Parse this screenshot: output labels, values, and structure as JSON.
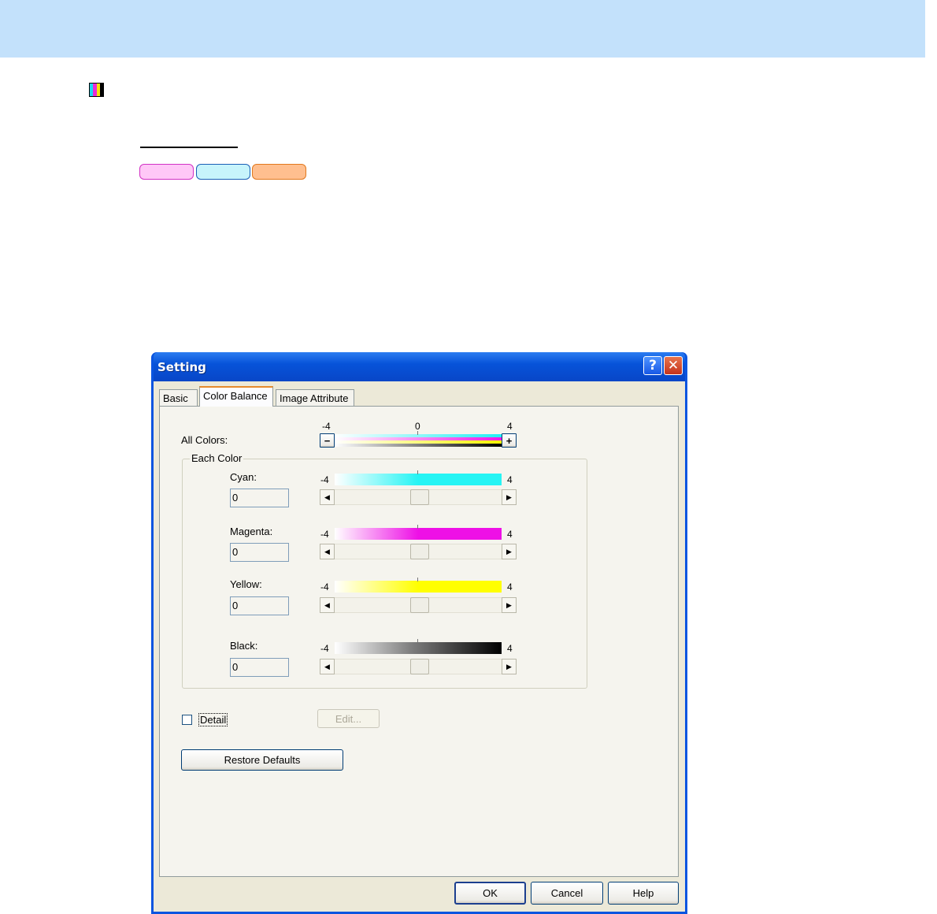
{
  "header_band_color": "#c3e1fb",
  "pills": {
    "colors": [
      "#ffc8f7",
      "#c7f4fb",
      "#ffbf8f"
    ]
  },
  "dialog": {
    "title": "Setting",
    "help_icon": "question-icon",
    "close_icon": "close-x-icon",
    "tabs": [
      {
        "label": "Basic",
        "active": false
      },
      {
        "label": "Color Balance",
        "active": true
      },
      {
        "label": "Image Attribute",
        "active": false
      }
    ],
    "all_colors": {
      "label": "All Colors:",
      "scale_min": "-4",
      "scale_mid": "0",
      "scale_max": "4",
      "minus_label": "−",
      "plus_label": "+"
    },
    "each_color_group_label": "Each Color",
    "colors": [
      {
        "label": "Cyan:",
        "value": "0",
        "min": "-4",
        "max": "4",
        "color": "#26f4f4",
        "level": 0
      },
      {
        "label": "Magenta:",
        "value": "0",
        "min": "-4",
        "max": "4",
        "color": "#ee10e6",
        "level": 0
      },
      {
        "label": "Yellow:",
        "value": "0",
        "min": "-4",
        "max": "4",
        "color": "#ffff00",
        "level": 0
      },
      {
        "label": "Black:",
        "value": "0",
        "min": "-4",
        "max": "4",
        "color": "#000000",
        "level": 0
      }
    ],
    "detail_label": "Detail",
    "detail_checked": false,
    "edit_label": "Edit...",
    "restore_defaults_label": "Restore Defaults",
    "ok_label": "OK",
    "cancel_label": "Cancel",
    "help_label": "Help"
  }
}
